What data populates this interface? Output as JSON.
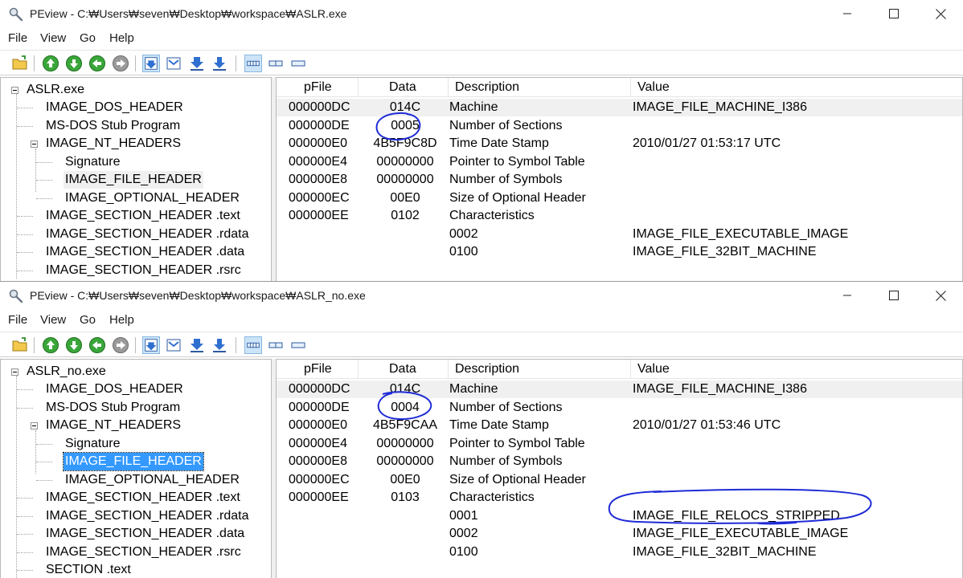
{
  "colors": {
    "annotation_ink": "#1e2bd6",
    "selection_active": "#3399ff",
    "selection_inactive": "#f0f0f0"
  },
  "menu": [
    "File",
    "View",
    "Go",
    "Help"
  ],
  "window_buttons": {
    "minimize": "minimize-icon",
    "maximize": "maximize-icon",
    "close": "close-icon"
  },
  "toolbar_icons": [
    "open-folder-icon",
    "up-arrow-icon",
    "down-arrow-icon",
    "back-arrow-icon",
    "forward-arrow-icon",
    "view-hex-icon",
    "view-text-icon",
    "view-address-icon",
    "view-byte-icon",
    "view-word-icon",
    "view-dword-icon",
    "view-qword-icon"
  ],
  "list_headers": {
    "pfile": "pFile",
    "data": "Data",
    "description": "Description",
    "value": "Value"
  },
  "top": {
    "title": "PEview - C:₩Users₩seven₩Desktop₩workspace₩ASLR.exe",
    "tree": [
      "ASLR.exe",
      "IMAGE_DOS_HEADER",
      "MS-DOS Stub Program",
      "IMAGE_NT_HEADERS",
      "Signature",
      "IMAGE_FILE_HEADER",
      "IMAGE_OPTIONAL_HEADER",
      "IMAGE_SECTION_HEADER .text",
      "IMAGE_SECTION_HEADER .rdata",
      "IMAGE_SECTION_HEADER .data",
      "IMAGE_SECTION_HEADER .rsrc"
    ],
    "rows": [
      {
        "pfile": "000000DC",
        "data": "014C",
        "desc": "Machine",
        "value": "IMAGE_FILE_MACHINE_I386"
      },
      {
        "pfile": "000000DE",
        "data": "0005",
        "desc": "Number of Sections",
        "value": ""
      },
      {
        "pfile": "000000E0",
        "data": "4B5F9C8D",
        "desc": "Time Date Stamp",
        "value": "2010/01/27  01:53:17 UTC"
      },
      {
        "pfile": "000000E4",
        "data": "00000000",
        "desc": "Pointer to Symbol Table",
        "value": ""
      },
      {
        "pfile": "000000E8",
        "data": "00000000",
        "desc": "Number of Symbols",
        "value": ""
      },
      {
        "pfile": "000000EC",
        "data": "00E0",
        "desc": "Size of Optional Header",
        "value": ""
      },
      {
        "pfile": "000000EE",
        "data": "0102",
        "desc": "Characteristics",
        "value": ""
      },
      {
        "pfile": "",
        "data": "",
        "desc": "0002",
        "value": "IMAGE_FILE_EXECUTABLE_IMAGE"
      },
      {
        "pfile": "",
        "data": "",
        "desc": "0100",
        "value": "IMAGE_FILE_32BIT_MACHINE"
      }
    ]
  },
  "bottom": {
    "title": "PEview - C:₩Users₩seven₩Desktop₩workspace₩ASLR_no.exe",
    "tree": [
      "ASLR_no.exe",
      "IMAGE_DOS_HEADER",
      "MS-DOS Stub Program",
      "IMAGE_NT_HEADERS",
      "Signature",
      "IMAGE_FILE_HEADER",
      "IMAGE_OPTIONAL_HEADER",
      "IMAGE_SECTION_HEADER .text",
      "IMAGE_SECTION_HEADER .rdata",
      "IMAGE_SECTION_HEADER .data",
      "IMAGE_SECTION_HEADER .rsrc",
      "SECTION .text"
    ],
    "rows": [
      {
        "pfile": "000000DC",
        "data": "014C",
        "desc": "Machine",
        "value": "IMAGE_FILE_MACHINE_I386"
      },
      {
        "pfile": "000000DE",
        "data": "0004",
        "desc": "Number of Sections",
        "value": ""
      },
      {
        "pfile": "000000E0",
        "data": "4B5F9CAA",
        "desc": "Time Date Stamp",
        "value": "2010/01/27  01:53:46 UTC"
      },
      {
        "pfile": "000000E4",
        "data": "00000000",
        "desc": "Pointer to Symbol Table",
        "value": ""
      },
      {
        "pfile": "000000E8",
        "data": "00000000",
        "desc": "Number of Symbols",
        "value": ""
      },
      {
        "pfile": "000000EC",
        "data": "00E0",
        "desc": "Size of Optional Header",
        "value": ""
      },
      {
        "pfile": "000000EE",
        "data": "0103",
        "desc": "Characteristics",
        "value": ""
      },
      {
        "pfile": "",
        "data": "",
        "desc": "0001",
        "value": "IMAGE_FILE_RELOCS_STRIPPED"
      },
      {
        "pfile": "",
        "data": "",
        "desc": "0002",
        "value": "IMAGE_FILE_EXECUTABLE_IMAGE"
      },
      {
        "pfile": "",
        "data": "",
        "desc": "0100",
        "value": "IMAGE_FILE_32BIT_MACHINE"
      }
    ]
  }
}
